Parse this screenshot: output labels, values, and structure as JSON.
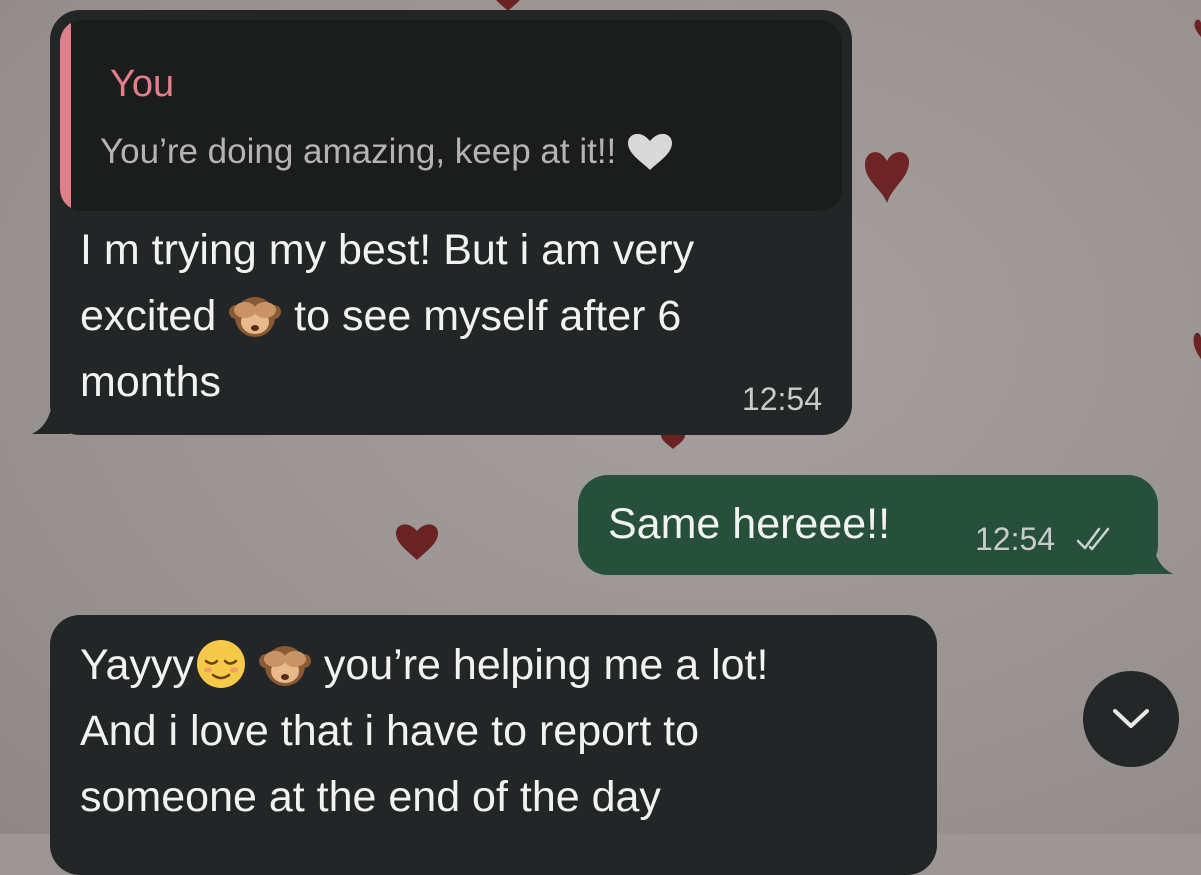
{
  "messages": [
    {
      "direction": "incoming",
      "quote": {
        "author": "You",
        "text": "You’re doing amazing, keep at it!!",
        "emoji": "white-heart"
      },
      "lines": [
        [
          "I m trying my best! But i am very"
        ],
        [
          "excited ",
          "see-no-evil-monkey",
          " to see myself after 6"
        ],
        [
          "months"
        ]
      ],
      "line_1": "I m trying my best! But i am very",
      "line_2a": "excited ",
      "line_2b": " to see myself after 6",
      "line_3": "months",
      "time": "12:54"
    },
    {
      "direction": "outgoing",
      "text": "Same hereee!!",
      "time": "12:54",
      "status": "read"
    },
    {
      "direction": "incoming",
      "line_1a": "Yayyy",
      "line_1b": " you’re helping me a lot!",
      "line_2": "And i love that i have to report to",
      "line_3": "someone at the end of the day",
      "emojis": [
        "relieved-face",
        "see-no-evil-monkey"
      ]
    }
  ],
  "scroll_button": {
    "icon": "chevron-down-icon"
  },
  "colors": {
    "incoming_bubble": "#232626",
    "outgoing_bubble": "#27503c",
    "quote_accent": "#e27f8a",
    "wallpaper": "#9c9694",
    "wallpaper_hearts": "#7a2a2a"
  }
}
